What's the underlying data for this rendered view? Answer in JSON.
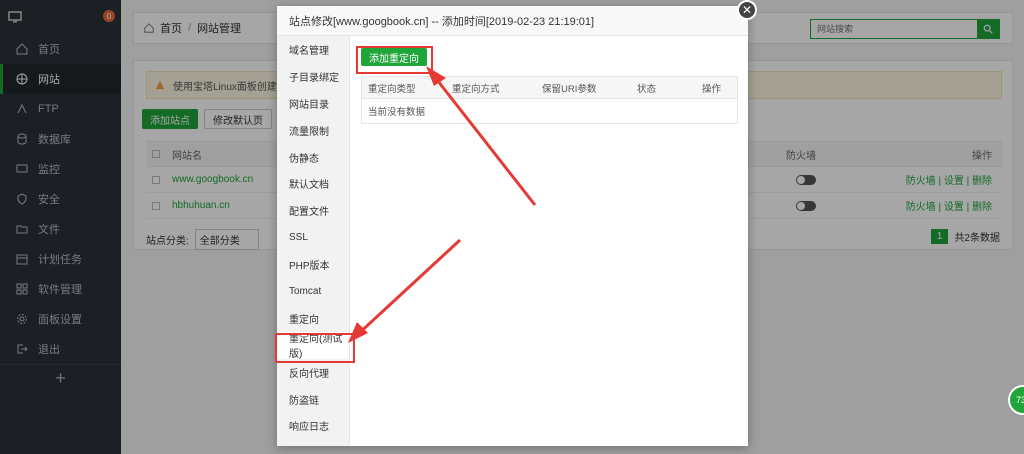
{
  "sidebar": {
    "badge": "0",
    "items": [
      {
        "label": "首页",
        "icon": "home-icon"
      },
      {
        "label": "网站",
        "icon": "globe-icon"
      },
      {
        "label": "FTP",
        "icon": "ftp-icon"
      },
      {
        "label": "数据库",
        "icon": "database-icon"
      },
      {
        "label": "监控",
        "icon": "monitor-icon"
      },
      {
        "label": "安全",
        "icon": "shield-icon"
      },
      {
        "label": "文件",
        "icon": "folder-icon"
      },
      {
        "label": "计划任务",
        "icon": "calendar-icon"
      },
      {
        "label": "软件管理",
        "icon": "apps-icon"
      },
      {
        "label": "面板设置",
        "icon": "settings-icon"
      },
      {
        "label": "退出",
        "icon": "logout-icon"
      }
    ],
    "add_label": "+"
  },
  "breadcrumb": {
    "home": "首页",
    "sep": "/",
    "current": "网站管理"
  },
  "search": {
    "placeholder": "网站搜索"
  },
  "alert": {
    "text": "使用宝塔Linux面板创建站点"
  },
  "toolbar": {
    "add_site": "添加站点",
    "edit_default": "修改默认页"
  },
  "table": {
    "col_name": "网站名",
    "col_firewall": "防火墙",
    "col_action": "操作",
    "rows": [
      {
        "name": "www.googbook.cn",
        "actions": "防火墙 | 设置 | 删除"
      },
      {
        "name": "hbhuhuan.cn",
        "actions": "防火墙 | 设置 | 删除"
      }
    ],
    "category_label": "站点分类:",
    "category_value": "全部分类",
    "page": "1",
    "total": "共2条数据"
  },
  "modal": {
    "title": "站点修改[www.googbook.cn] -- 添加时间[2019-02-23 21:19:01]",
    "nav": [
      "域名管理",
      "子目录绑定",
      "网站目录",
      "流量限制",
      "伪静态",
      "默认文档",
      "配置文件",
      "SSL",
      "PHP版本",
      "Tomcat",
      "重定向",
      "重定向(测试版)",
      "反向代理",
      "防盗链",
      "响应日志"
    ],
    "add_redirect": "添加重定向",
    "headers": [
      "重定向类型",
      "重定向方式",
      "保留URI参数",
      "状态",
      "操作"
    ],
    "empty": "当前没有数据"
  },
  "float_badge": "73"
}
